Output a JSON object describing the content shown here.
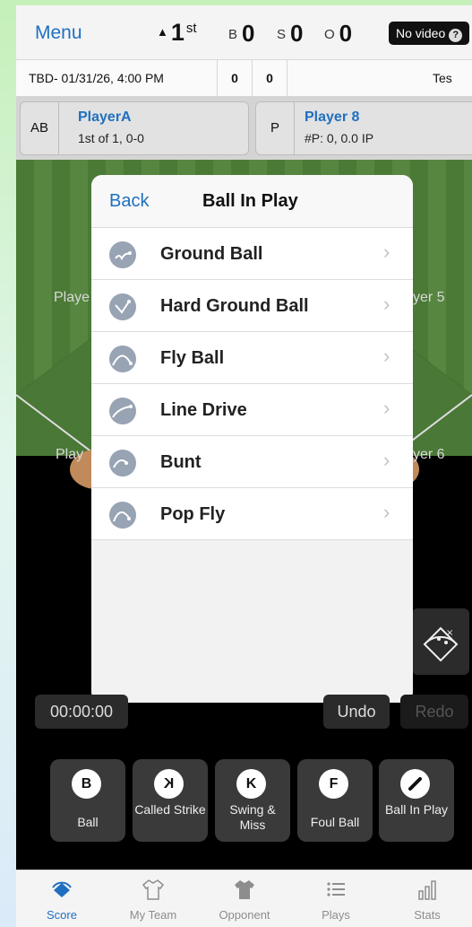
{
  "header": {
    "menu_label": "Menu",
    "inning_number": "1",
    "inning_ordinal": "st",
    "balls_label": "B",
    "balls": "0",
    "strikes_label": "S",
    "strikes": "0",
    "outs_label": "O",
    "outs": "0",
    "video_label": "No video",
    "video_help": "?"
  },
  "info_row": {
    "game": "TBD- 01/31/26, 4:00 PM",
    "score_home": "0",
    "score_away": "0",
    "team": "Tes"
  },
  "batter": {
    "position": "AB",
    "name": "PlayerA",
    "stat": "1st of 1, 0-0"
  },
  "pitcher": {
    "position": "P",
    "name": "Player 8",
    "stat": "#P: 0, 0.0 IP"
  },
  "field_labels": {
    "left_upper": "Playe",
    "right_upper": "yer 5",
    "left_lower": "Play",
    "right_lower": "yer 6"
  },
  "modal": {
    "back_label": "Back",
    "title": "Ball In Play",
    "options": [
      {
        "label": "Ground Ball",
        "icon": "ground-ball-icon"
      },
      {
        "label": "Hard Ground Ball",
        "icon": "hard-ground-ball-icon"
      },
      {
        "label": "Fly Ball",
        "icon": "fly-ball-icon"
      },
      {
        "label": "Line Drive",
        "icon": "line-drive-icon"
      },
      {
        "label": "Bunt",
        "icon": "bunt-icon"
      },
      {
        "label": "Pop Fly",
        "icon": "pop-fly-icon"
      }
    ]
  },
  "controls": {
    "timer": "00:00:00",
    "undo": "Undo",
    "redo": "Redo"
  },
  "pitches": [
    {
      "letter": "B",
      "label": "Ball"
    },
    {
      "letter": "K",
      "label": "Called Strike"
    },
    {
      "letter": "K",
      "label": "Swing & Miss"
    },
    {
      "letter": "F",
      "label": "Foul Ball"
    },
    {
      "letter": "",
      "label": "Ball In Play"
    }
  ],
  "tabs": [
    {
      "label": "Score",
      "icon": "diamond-icon",
      "active": true
    },
    {
      "label": "My Team",
      "icon": "jersey-outline-icon",
      "active": false
    },
    {
      "label": "Opponent",
      "icon": "jersey-filled-icon",
      "active": false
    },
    {
      "label": "Plays",
      "icon": "list-icon",
      "active": false
    },
    {
      "label": "Stats",
      "icon": "bar-chart-icon",
      "active": false
    }
  ],
  "colors": {
    "accent": "#1f6fc0",
    "icon_gray": "#98a3b3",
    "grass": "#4b7a37"
  }
}
